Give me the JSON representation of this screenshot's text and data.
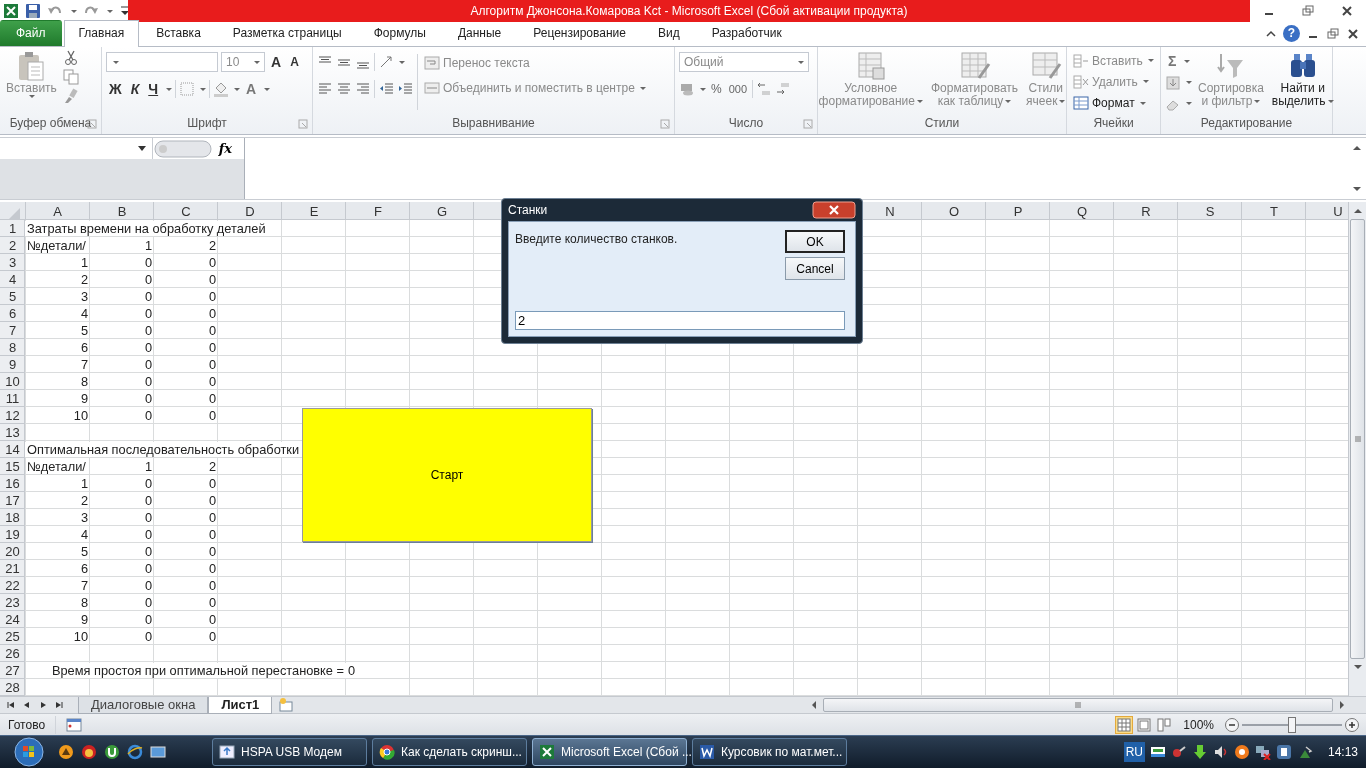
{
  "window": {
    "title": "Алгоритм Джонсона.Комарова Kct  -  Microsoft Excel (Сбой активации продукта)",
    "help_button": "?"
  },
  "ribbon_tabs": [
    {
      "label": "Файл",
      "kind": "file",
      "selected": false
    },
    {
      "label": "Главная",
      "kind": "tab",
      "selected": true
    },
    {
      "label": "Вставка",
      "kind": "tab",
      "selected": false
    },
    {
      "label": "Разметка страницы",
      "kind": "tab",
      "selected": false
    },
    {
      "label": "Формулы",
      "kind": "tab",
      "selected": false
    },
    {
      "label": "Данные",
      "kind": "tab",
      "selected": false
    },
    {
      "label": "Рецензирование",
      "kind": "tab",
      "selected": false
    },
    {
      "label": "Вид",
      "kind": "tab",
      "selected": false
    },
    {
      "label": "Разработчик",
      "kind": "tab",
      "selected": false
    }
  ],
  "ribbon": {
    "clipboard": {
      "label": "Буфер обмена",
      "paste": {
        "label": "Вставить",
        "disabled": true
      }
    },
    "font": {
      "label": "Шрифт",
      "size": "10",
      "grow": "A",
      "shrink": "A",
      "bold": "Ж",
      "italic": "К",
      "underline": "Ч",
      "font_color_button": "A"
    },
    "alignment": {
      "label": "Выравнивание",
      "wrap": {
        "label": "Перенос текста",
        "disabled": true
      },
      "merge": {
        "label": "Объединить и поместить в центре",
        "disabled": true
      }
    },
    "number": {
      "label": "Число",
      "format": {
        "value": "Общий",
        "disabled": true
      },
      "percent": "%",
      "thousands": "000"
    },
    "styles": {
      "label": "Стили",
      "conditional": {
        "label": "Условное\nформатирование",
        "disabled": true
      },
      "as_table": {
        "label": "Форматировать\nкак таблицу",
        "disabled": true
      },
      "cell_styles": {
        "label": "Стили\nячеек",
        "disabled": true
      }
    },
    "cells": {
      "label": "Ячейки",
      "insert": {
        "label": "Вставить",
        "disabled": true
      },
      "delete": {
        "label": "Удалить",
        "disabled": true
      },
      "format": {
        "label": "Формат",
        "disabled": false
      }
    },
    "editing": {
      "label": "Редактирование",
      "sum": "Σ",
      "sort": {
        "label": "Сортировка\nи фильтр",
        "disabled": true
      },
      "find": {
        "label": "Найти и\nвыделить",
        "disabled": false
      }
    }
  },
  "formula_bar": {
    "fx_label": "fx"
  },
  "sheet": {
    "column_headers": {
      "left": [
        "A",
        "B",
        "C",
        "D",
        "E",
        "F",
        "G"
      ],
      "right": [
        "N",
        "O",
        "P",
        "Q",
        "R",
        "S",
        "T",
        "U"
      ]
    },
    "rows": [
      {
        "header": "1",
        "kind": "title",
        "text": "Затраты времени на обработку деталей"
      },
      {
        "header": "2",
        "kind": "header",
        "cells": [
          "№детали/",
          "1",
          "2"
        ]
      },
      {
        "header": "3",
        "kind": "data",
        "cells": [
          "1",
          "0",
          "0"
        ]
      },
      {
        "header": "4",
        "kind": "data",
        "cells": [
          "2",
          "0",
          "0"
        ]
      },
      {
        "header": "5",
        "kind": "data",
        "cells": [
          "3",
          "0",
          "0"
        ]
      },
      {
        "header": "6",
        "kind": "data",
        "cells": [
          "4",
          "0",
          "0"
        ]
      },
      {
        "header": "7",
        "kind": "data",
        "cells": [
          "5",
          "0",
          "0"
        ]
      },
      {
        "header": "8",
        "kind": "data",
        "cells": [
          "6",
          "0",
          "0"
        ]
      },
      {
        "header": "9",
        "kind": "data",
        "cells": [
          "7",
          "0",
          "0"
        ]
      },
      {
        "header": "10",
        "kind": "data",
        "cells": [
          "8",
          "0",
          "0"
        ]
      },
      {
        "header": "11",
        "kind": "data",
        "cells": [
          "9",
          "0",
          "0"
        ]
      },
      {
        "header": "12",
        "kind": "data",
        "cells": [
          "10",
          "0",
          "0"
        ]
      },
      {
        "header": "13",
        "kind": "empty"
      },
      {
        "header": "14",
        "kind": "title",
        "text": "Оптимальная последовательность обработки"
      },
      {
        "header": "15",
        "kind": "header",
        "cells": [
          "№детали/",
          "1",
          "2"
        ]
      },
      {
        "header": "16",
        "kind": "data",
        "cells": [
          "1",
          "0",
          "0"
        ]
      },
      {
        "header": "17",
        "kind": "data",
        "cells": [
          "2",
          "0",
          "0"
        ]
      },
      {
        "header": "18",
        "kind": "data",
        "cells": [
          "3",
          "0",
          "0"
        ]
      },
      {
        "header": "19",
        "kind": "data",
        "cells": [
          "4",
          "0",
          "0"
        ]
      },
      {
        "header": "20",
        "kind": "data",
        "cells": [
          "5",
          "0",
          "0"
        ]
      },
      {
        "header": "21",
        "kind": "data",
        "cells": [
          "6",
          "0",
          "0"
        ]
      },
      {
        "header": "22",
        "kind": "data",
        "cells": [
          "7",
          "0",
          "0"
        ]
      },
      {
        "header": "23",
        "kind": "data",
        "cells": [
          "8",
          "0",
          "0"
        ]
      },
      {
        "header": "24",
        "kind": "data",
        "cells": [
          "9",
          "0",
          "0"
        ]
      },
      {
        "header": "25",
        "kind": "data",
        "cells": [
          "10",
          "0",
          "0"
        ]
      },
      {
        "header": "26",
        "kind": "empty"
      },
      {
        "header": "27",
        "kind": "summary",
        "label": "Время простоя при оптимальной перестановке =",
        "value": "0"
      },
      {
        "header": "28",
        "kind": "empty"
      }
    ]
  },
  "start_button": {
    "label": "Старт"
  },
  "dialog": {
    "title": "Станки",
    "prompt": "Введите количество станков.",
    "ok": "OK",
    "cancel": "Cancel",
    "value": "2"
  },
  "sheet_tabs": [
    {
      "label": "Диалоговые окна",
      "selected": false
    },
    {
      "label": "Лист1",
      "selected": true
    }
  ],
  "status_bar": {
    "status": "Готово",
    "views": [
      {
        "kind": "normal",
        "selected": true
      },
      {
        "kind": "page_layout",
        "selected": false
      },
      {
        "kind": "page_break",
        "selected": false
      }
    ],
    "zoom": "100%",
    "zoom_slider": {
      "level": 0.5
    }
  },
  "taskbar": {
    "buttons": [
      {
        "label": "HSPA USB Модем",
        "kind": "modem",
        "selected": false
      },
      {
        "label": "Как сделать скринш...",
        "kind": "browser",
        "selected": false
      },
      {
        "label": "Microsoft Excel (Сбой ...",
        "kind": "spreadsheet",
        "selected": true
      },
      {
        "label": "Курсовик по мат.мет...",
        "kind": "document",
        "selected": false
      }
    ],
    "language": "RU",
    "clock": "14:13"
  }
}
